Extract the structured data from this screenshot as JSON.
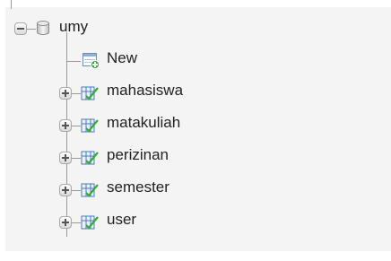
{
  "tree": {
    "database": {
      "name": "umy",
      "icon": "database-icon",
      "expanded": true
    },
    "new_item": {
      "label": "New",
      "icon": "new-table-icon"
    },
    "tables": [
      {
        "label": "mahasiswa",
        "icon": "table-icon"
      },
      {
        "label": "matakuliah",
        "icon": "table-icon"
      },
      {
        "label": "perizinan",
        "icon": "table-icon"
      },
      {
        "label": "semester",
        "icon": "table-icon"
      },
      {
        "label": "user",
        "icon": "table-icon"
      }
    ]
  },
  "colors": {
    "panel_background": "#f4f4f4",
    "tree_line": "#9a9a9a",
    "table_icon_green": "#3aa93a",
    "table_icon_blue": "#4a7ab8"
  }
}
